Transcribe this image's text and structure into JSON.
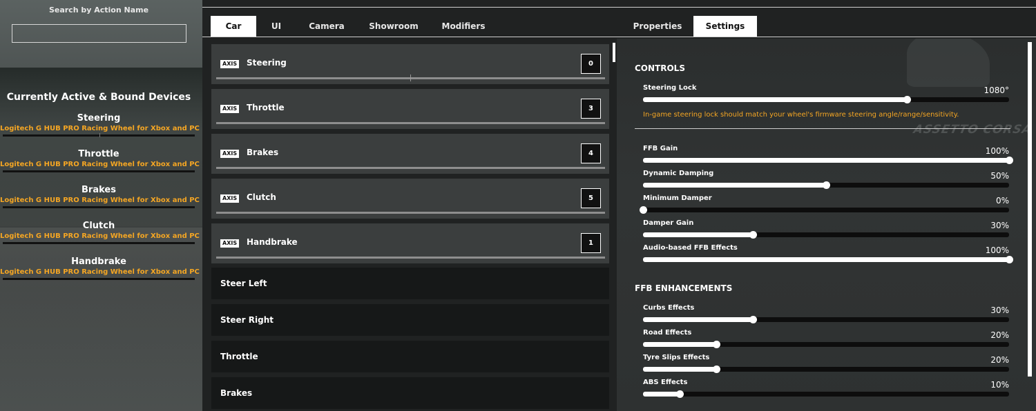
{
  "left_panel": {
    "search_title": "Search by Action Name",
    "search_value": "",
    "devices_title": "Currently Active & Bound Devices",
    "devices": [
      {
        "name": "Steering",
        "device": "Logitech G HUB PRO Racing Wheel for Xbox and PC (USB)"
      },
      {
        "name": "Throttle",
        "device": "Logitech G HUB PRO Racing Wheel for Xbox and PC (USB)"
      },
      {
        "name": "Brakes",
        "device": "Logitech G HUB PRO Racing Wheel for Xbox and PC (USB)"
      },
      {
        "name": "Clutch",
        "device": "Logitech G HUB PRO Racing Wheel for Xbox and PC (USB)"
      },
      {
        "name": "Handbrake",
        "device": "Logitech G HUB PRO Racing Wheel for Xbox and PC (USB)"
      }
    ]
  },
  "tabs": {
    "left": [
      {
        "label": "Car",
        "active": true
      },
      {
        "label": "UI",
        "active": false
      },
      {
        "label": "Camera",
        "active": false
      },
      {
        "label": "Showroom",
        "active": false
      },
      {
        "label": "Modifiers",
        "active": false
      }
    ],
    "right": [
      {
        "label": "Properties",
        "active": false
      },
      {
        "label": "Settings",
        "active": true
      }
    ]
  },
  "actions": {
    "axis_badge": "AXIS",
    "axes": [
      {
        "label": "Steering",
        "value": "0"
      },
      {
        "label": "Throttle",
        "value": "3"
      },
      {
        "label": "Brakes",
        "value": "4"
      },
      {
        "label": "Clutch",
        "value": "5"
      },
      {
        "label": "Handbrake",
        "value": "1"
      }
    ],
    "buttons": [
      {
        "label": "Steer Left"
      },
      {
        "label": "Steer Right"
      },
      {
        "label": "Throttle"
      },
      {
        "label": "Brakes"
      }
    ]
  },
  "settings": {
    "controls_title": "CONTROLS",
    "steering_lock": {
      "label": "Steering Lock",
      "value": "1080°",
      "fraction": 0.72
    },
    "steering_note": "In-game steering lock should match your wheel's firmware steering angle/range/sensitivity.",
    "controls": [
      {
        "label": "FFB Gain",
        "value": "100%",
        "fraction": 1.0
      },
      {
        "label": "Dynamic Damping",
        "value": "50%",
        "fraction": 0.5
      },
      {
        "label": "Minimum Damper",
        "value": "0%",
        "fraction": 0.0
      },
      {
        "label": "Damper Gain",
        "value": "30%",
        "fraction": 0.3
      },
      {
        "label": "Audio-based FFB Effects",
        "value": "100%",
        "fraction": 1.0
      }
    ],
    "ffb_title": "FFB ENHANCEMENTS",
    "ffb": [
      {
        "label": "Curbs Effects",
        "value": "30%",
        "fraction": 0.3
      },
      {
        "label": "Road Effects",
        "value": "20%",
        "fraction": 0.2
      },
      {
        "label": "Tyre Slips Effects",
        "value": "20%",
        "fraction": 0.2
      },
      {
        "label": "ABS Effects",
        "value": "10%",
        "fraction": 0.1
      }
    ],
    "background_logo": "ASSETTO CORSA"
  }
}
